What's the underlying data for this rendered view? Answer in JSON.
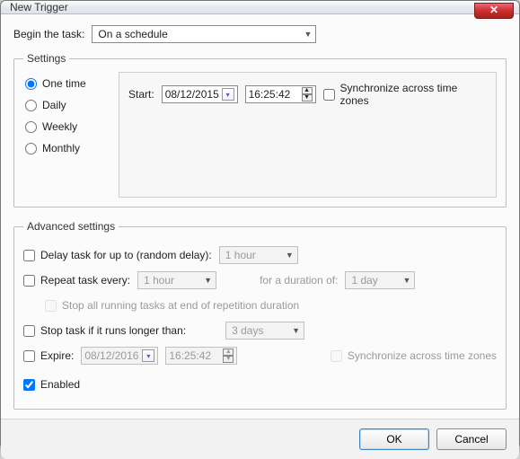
{
  "window": {
    "title": "New Trigger"
  },
  "begin": {
    "label": "Begin the task:",
    "value": "On a schedule"
  },
  "settings": {
    "legend": "Settings",
    "radios": {
      "onetime": "One time",
      "daily": "Daily",
      "weekly": "Weekly",
      "monthly": "Monthly"
    },
    "start_label": "Start:",
    "date": "08/12/2015",
    "time": "16:25:42",
    "sync_label": "Synchronize across time zones"
  },
  "advanced": {
    "legend": "Advanced settings",
    "delay_label": "Delay task for up to (random delay):",
    "delay_value": "1 hour",
    "repeat_label": "Repeat task every:",
    "repeat_value": "1 hour",
    "duration_label": "for a duration of:",
    "duration_value": "1 day",
    "stopall_label": "Stop all running tasks at end of repetition duration",
    "stoplong_label": "Stop task if it runs longer than:",
    "stoplong_value": "3 days",
    "expire_label": "Expire:",
    "expire_date": "08/12/2016",
    "expire_time": "16:25:42",
    "expire_sync_label": "Synchronize across time zones",
    "enabled_label": "Enabled"
  },
  "buttons": {
    "ok": "OK",
    "cancel": "Cancel"
  }
}
